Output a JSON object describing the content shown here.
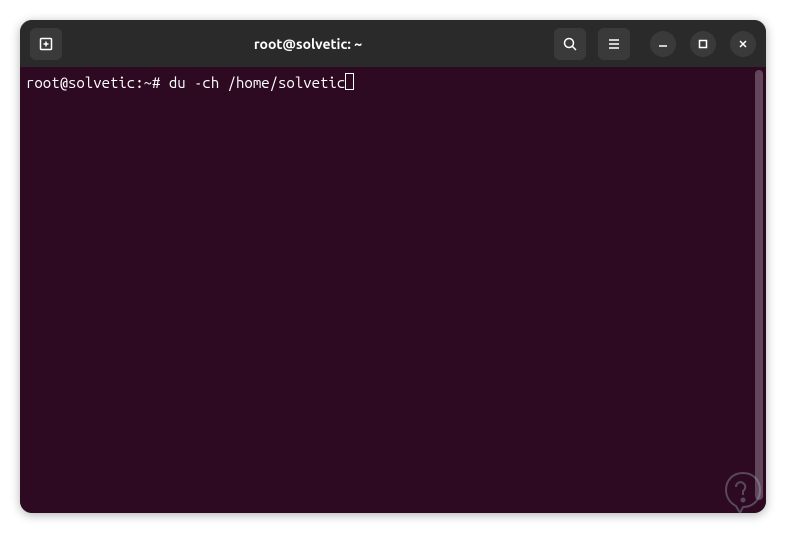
{
  "window": {
    "title": "root@solvetic: ~"
  },
  "terminal": {
    "prompt_user_host": "root@solvetic",
    "prompt_path": "~",
    "prompt_symbol": "#",
    "command": "du -ch /home/solvetic"
  },
  "colors": {
    "titlebar_bg": "#2a2a2a",
    "terminal_bg": "#2d0a22",
    "text": "#ffffff"
  }
}
